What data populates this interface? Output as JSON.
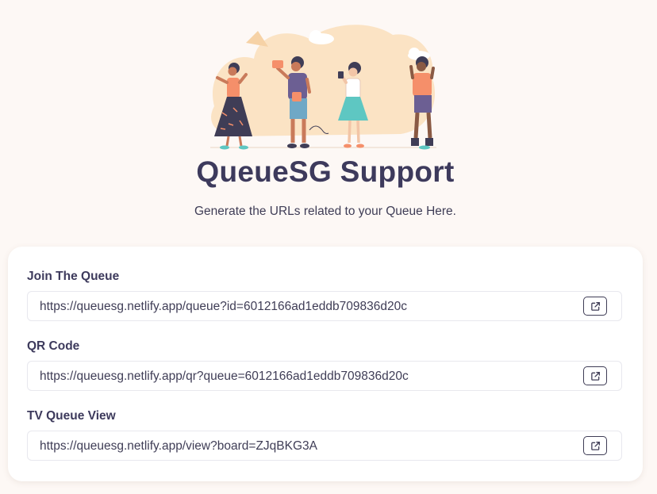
{
  "page": {
    "title": "QueueSG Support",
    "subtitle": "Generate the URLs related to your Queue Here."
  },
  "hero": {
    "icon": "people-queue-illustration"
  },
  "links": [
    {
      "label": "Join The Queue",
      "url": "https://queuesg.netlify.app/queue?id=6012166ad1eddb709836d20c",
      "action_icon": "external-link-icon"
    },
    {
      "label": "QR Code",
      "url": "https://queuesg.netlify.app/qr?queue=6012166ad1eddb709836d20c",
      "action_icon": "external-link-icon"
    },
    {
      "label": "TV Queue View",
      "url": "https://queuesg.netlify.app/view?board=ZJqBKG3A",
      "action_icon": "external-link-icon"
    }
  ],
  "colors": {
    "background": "#fdf8f5",
    "text": "#3f3d56",
    "accent": "#f7a86a",
    "card": "#ffffff"
  }
}
